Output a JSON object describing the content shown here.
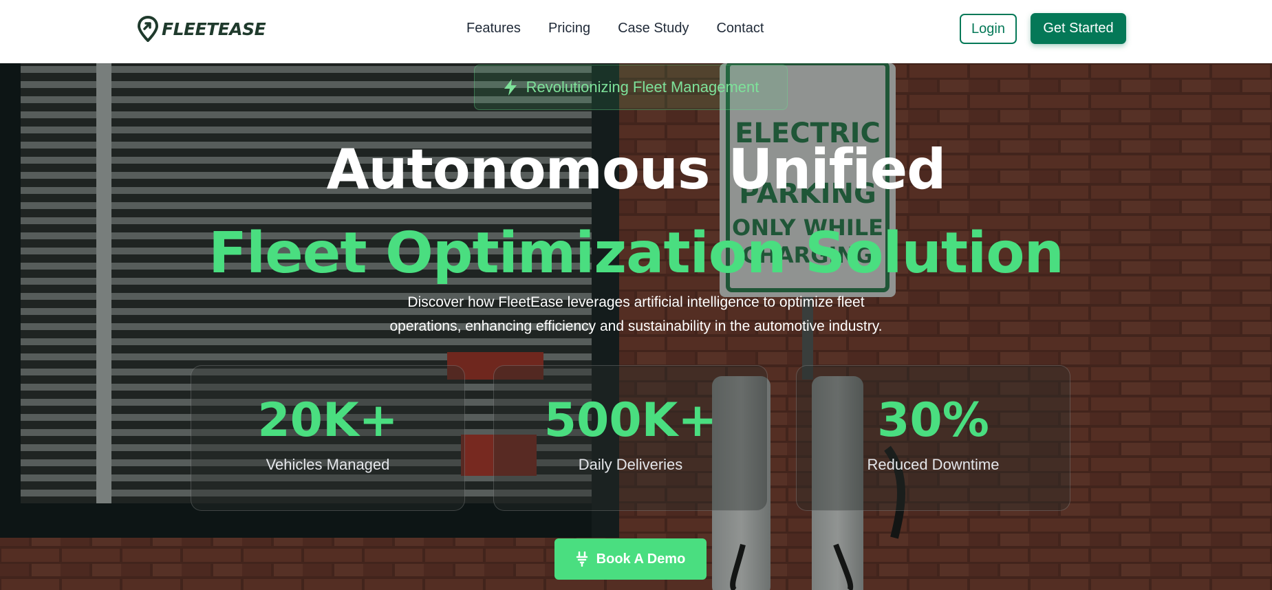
{
  "brand": {
    "name": "FLEETEASE"
  },
  "nav": {
    "links": [
      "Features",
      "Pricing",
      "Case Study",
      "Contact"
    ],
    "login_label": "Login",
    "cta_label": "Get Started"
  },
  "hero": {
    "badge": "Revolutionizing Fleet Management",
    "headline_line1": "Autonomous Unified",
    "headline_line2": "Fleet Optimization Solution",
    "subtitle_line1": "Discover how FleetEase leverages artificial intelligence to optimize fleet",
    "subtitle_line2": "operations, enhancing efficiency and sustainability in the automotive industry.",
    "background_image": "Electric vehicle charging station against a brick wall",
    "background_sign_text": [
      "ELECTRIC",
      "PARKING",
      "ONLY WHILE",
      "CHARGING"
    ],
    "stats": [
      {
        "value": "20K+",
        "label": "Vehicles Managed"
      },
      {
        "value": "500K+",
        "label": "Daily Deliveries"
      },
      {
        "value": "30%",
        "label": "Reduced Downtime"
      }
    ],
    "demo_label": "Book A Demo"
  },
  "colors": {
    "brand_dark": "#047857",
    "accent_green": "#4ade80",
    "logo_text": "#1f3a2c"
  },
  "icons": {
    "logo": "location-pin-arrow-icon",
    "badge": "lightning-bolt-icon",
    "demo": "plug-icon"
  }
}
